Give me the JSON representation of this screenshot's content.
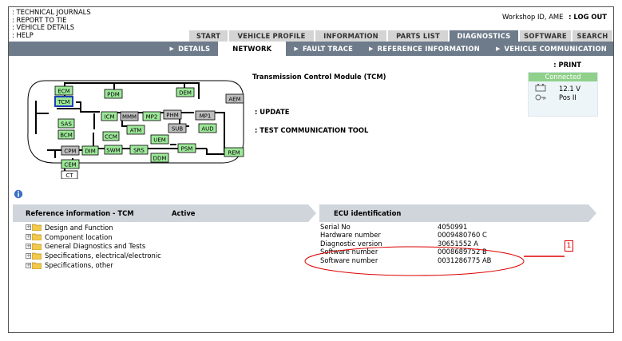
{
  "top_links": [
    ": TECHNICAL JOURNALS",
    ": REPORT TO TIE",
    ": VEHICLE DETAILS",
    ": HELP"
  ],
  "user": {
    "workshop": "Workshop ID, AME",
    "logout": ": LOG OUT"
  },
  "tabs": [
    {
      "label": "START",
      "active": false
    },
    {
      "label": "VEHICLE PROFILE",
      "active": false
    },
    {
      "label": "INFORMATION",
      "active": false
    },
    {
      "label": "PARTS LIST",
      "active": false
    },
    {
      "label": "DIAGNOSTICS",
      "active": true
    },
    {
      "label": "SOFTWARE",
      "active": false
    },
    {
      "label": "SEARCH",
      "active": false
    }
  ],
  "subnav": [
    {
      "label": "DETAILS",
      "active": false
    },
    {
      "label": "NETWORK",
      "active": true
    },
    {
      "label": "FAULT TRACE",
      "active": false
    },
    {
      "label": "REFERENCE INFORMATION",
      "active": false
    },
    {
      "label": "VEHICLE COMMUNICATION",
      "active": false
    }
  ],
  "network": {
    "modules": [
      "ECM",
      "TCM",
      "PDM",
      "DEM",
      "AEM",
      "ICM",
      "MMM",
      "MP2",
      "PHM",
      "MP1",
      "ATM",
      "SUB",
      "AUD",
      "SAS",
      "BCM",
      "CCM",
      "UEM",
      "CPM",
      "DIM",
      "SWM",
      "SRS",
      "PSM",
      "REM",
      "CEM",
      "DDM",
      "CT"
    ],
    "selected": "TCM",
    "colors": {
      "node": "#9ee89a",
      "grey_node": "#bdbdbd",
      "selected_border": "#1e3fb8"
    }
  },
  "module_title": "Transmission Control Module (TCM)",
  "actions": {
    "update": ": UPDATE",
    "test_tool": ": TEST COMMUNICATION TOOL"
  },
  "print_label": ": PRINT",
  "status": {
    "connection": "Connected",
    "voltage": "12.1 V",
    "key_position": "Pos II",
    "color": "#8fd08a"
  },
  "reference": {
    "header": "Reference information - TCM",
    "state": "Active",
    "items": [
      "Design and Function",
      "Component location",
      "General Diagnostics and Tests",
      "Specifications, electrical/electronic",
      "Specifications, other"
    ]
  },
  "ecu": {
    "header": "ECU identification",
    "rows": [
      {
        "label": "Serial No",
        "value": "4050991"
      },
      {
        "label": "Hardware number",
        "value": "0009480760  C"
      },
      {
        "label": "Diagnostic version",
        "value": "30651552  A"
      },
      {
        "label": "Software number",
        "value": "0008689752  B"
      },
      {
        "label": "Software number",
        "value": "0031286775 AB"
      }
    ]
  },
  "annotation": {
    "marker": "1",
    "color": "#dd0000"
  }
}
